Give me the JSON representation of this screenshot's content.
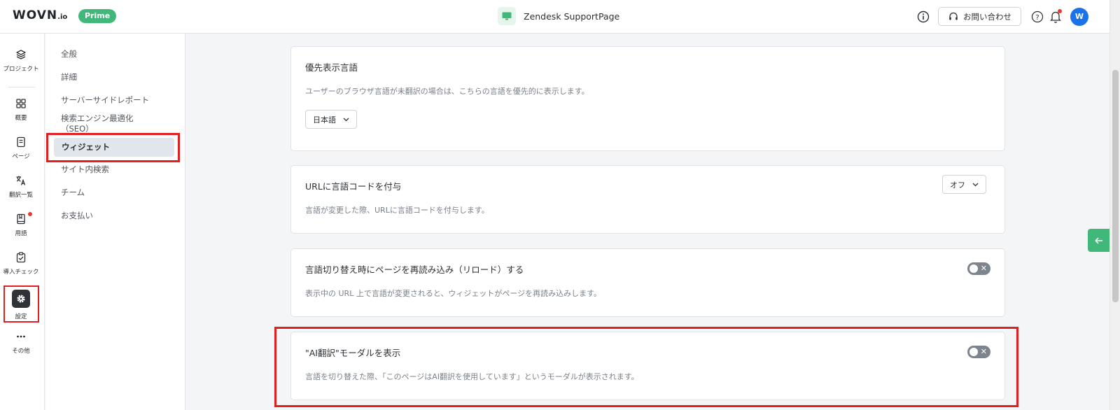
{
  "header": {
    "logo": "WOVN",
    "logo_suffix": ".io",
    "plan_badge": "Prime",
    "project_name": "Zendesk SupportPage",
    "contact_label": "お問い合わせ",
    "avatar_initial": "W"
  },
  "rail": {
    "items": [
      {
        "label": "プロジェクト",
        "icon": "layers-icon"
      },
      {
        "label": "概要",
        "icon": "grid-icon"
      },
      {
        "label": "ページ",
        "icon": "page-icon"
      },
      {
        "label": "翻訳一覧",
        "icon": "translate-icon"
      },
      {
        "label": "用語",
        "icon": "book-icon"
      },
      {
        "label": "導入チェック",
        "icon": "checklist-icon"
      },
      {
        "label": "設定",
        "icon": "gear-icon"
      },
      {
        "label": "その他",
        "icon": "more-icon"
      }
    ]
  },
  "subnav": {
    "items": [
      {
        "label": "全般"
      },
      {
        "label": "詳細"
      },
      {
        "label": "サーバーサイドレポート"
      },
      {
        "label": "検索エンジン最適化"
      },
      {
        "label": "（SEO）"
      },
      {
        "label": "ウィジェット"
      },
      {
        "label": "サイト内検索"
      },
      {
        "label": "チーム"
      },
      {
        "label": "お支払い"
      }
    ]
  },
  "cards": [
    {
      "title": "優先表示言語",
      "desc": "ユーザーのブラウザ言語が未翻訳の場合は、こちらの言語を優先的に表示します。",
      "select": "日本語"
    },
    {
      "title": "URLに言語コードを付与",
      "desc": "言語が変更した際、URLに言語コードを付与します。",
      "select": "オフ"
    },
    {
      "title": "言語切り替え時にページを再読み込み（リロード）する",
      "desc": "表示中の URL 上で言語が変更されると、ウィジェットがページを再読み込みします。",
      "toggle_mark": "✕",
      "toggle_on": false
    },
    {
      "title": "\"AI翻訳\"モーダルを表示",
      "desc": "言語を切り替えた際、「このページはAI翻訳を使用しています」というモーダルが表示されます。",
      "toggle_mark": "✕",
      "toggle_on": false
    }
  ],
  "colors": {
    "brand_green": "#3fb87a",
    "highlight_red": "#e02020",
    "avatar_blue": "#1a73e8"
  }
}
